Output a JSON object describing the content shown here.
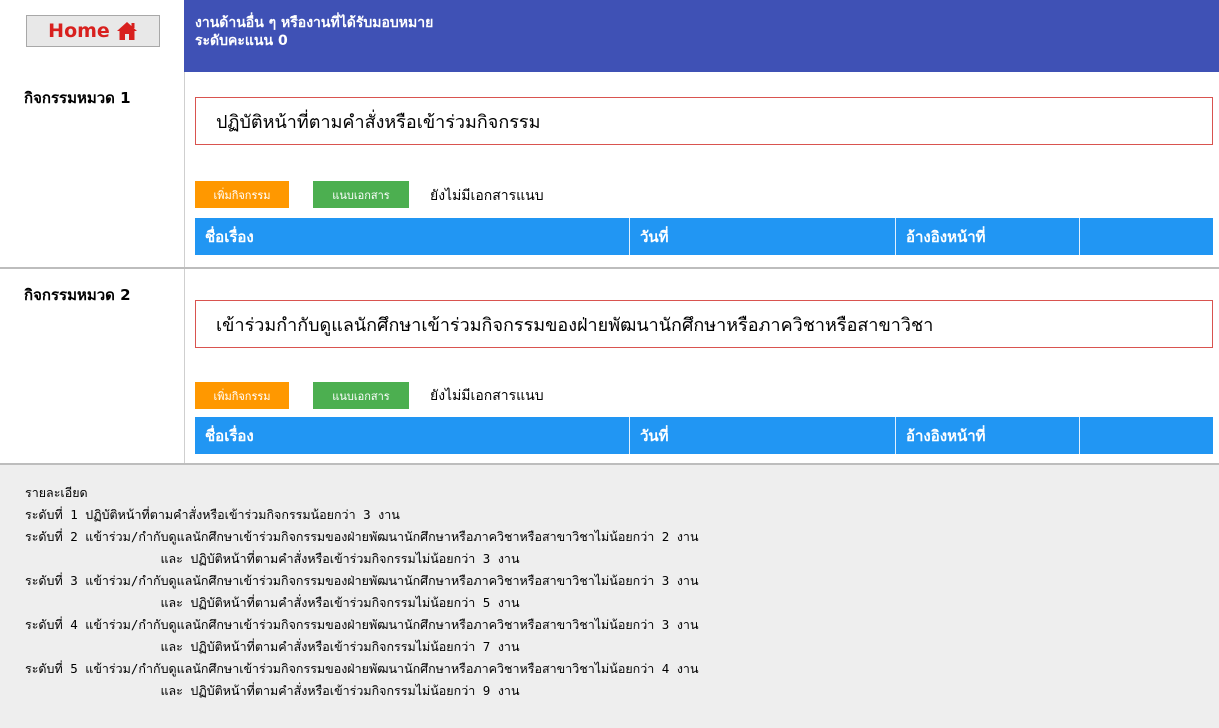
{
  "header": {
    "home_label": "Home",
    "home_icon": "home-icon",
    "title": "งานด้านอื่น ๆ หรืองานที่ได้รับมอบหมาย",
    "level": "ระดับคะแนน 0",
    "accent": "#3f51b5"
  },
  "columns": [
    "ชื่อเรื่อง",
    "วันที่",
    "อ้างอิงหน้าที่",
    ""
  ],
  "sections": [
    {
      "category": "กิจกรรมหมวด 1",
      "activity": "ปฏิบัติหน้าที่ตามคำสั่งหรือเข้าร่วมกิจกรรม",
      "add_label": "เพิ่มกิจกรรม",
      "attach_label": "แนบเอกสาร",
      "status": "ยังไม่มีเอกสารแนบ"
    },
    {
      "category": "กิจกรรมหมวด 2",
      "activity": "เข้าร่วมกำกับดูแลนักศึกษาเข้าร่วมกิจกรรมของฝ่ายพัฒนานักศึกษาหรือภาควิชาหรือสาขาวิชา",
      "add_label": "เพิ่มกิจกรรม",
      "attach_label": "แนบเอกสาร",
      "status": "ยังไม่มีเอกสารแนบ"
    }
  ],
  "details": {
    "heading": "รายละเอียด",
    "lines": [
      "ระดับที่ 1 ปฏิบัติหน้าที่ตามคำสั่งหรือเข้าร่วมกิจกรรมน้อยกว่า 3 งาน",
      "ระดับที่ 2 แข้าร่วม/กำกับดูแลนักศึกษาเข้าร่วมกิจกรรมของฝ่ายพัฒนานักศึกษาหรือภาควิชาหรือสาขาวิชาไม่น้อยกว่า 2 งาน",
      "                  และ ปฏิบัติหน้าที่ตามคำสั่งหรือเข้าร่วมกิจกรรมไม่น้อยกว่า 3 งาน",
      "ระดับที่ 3 แข้าร่วม/กำกับดูแลนักศึกษาเข้าร่วมกิจกรรมของฝ่ายพัฒนานักศึกษาหรือภาควิชาหรือสาขาวิชาไม่น้อยกว่า 3 งาน",
      "                  และ ปฏิบัติหน้าที่ตามคำสั่งหรือเข้าร่วมกิจกรรมไม่น้อยกว่า 5 งาน",
      "ระดับที่ 4 แข้าร่วม/กำกับดูแลนักศึกษาเข้าร่วมกิจกรรมของฝ่ายพัฒนานักศึกษาหรือภาควิชาหรือสาขาวิชาไม่น้อยกว่า 3 งาน",
      "                  และ ปฏิบัติหน้าที่ตามคำสั่งหรือเข้าร่วมกิจกรรมไม่น้อยกว่า 7 งาน",
      "ระดับที่ 5 แข้าร่วม/กำกับดูแลนักศึกษาเข้าร่วมกิจกรรมของฝ่ายพัฒนานักศึกษาหรือภาควิชาหรือสาขาวิชาไม่น้อยกว่า 4 งาน",
      "                  และ ปฏิบัติหน้าที่ตามคำสั่งหรือเข้าร่วมกิจกรรมไม่น้อยกว่า 9 งาน"
    ]
  }
}
